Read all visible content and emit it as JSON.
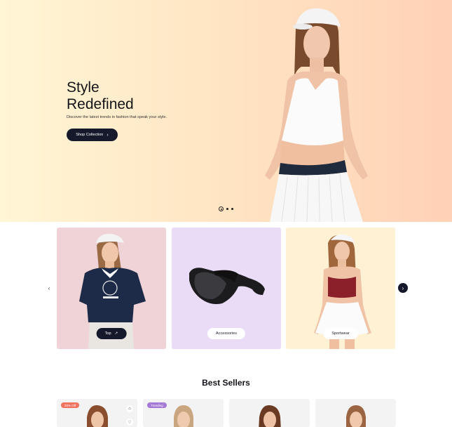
{
  "hero": {
    "title_line1": "Style",
    "title_line2": "Redefined",
    "subtitle": "Discover the latest trends in fashion that speak your style.",
    "cta_label": "Shop Collection",
    "slides_count": 3,
    "active_slide": 1
  },
  "categories": [
    {
      "label": "Top",
      "style": "dark"
    },
    {
      "label": "Accessories",
      "style": "light"
    },
    {
      "label": "Sportwear",
      "style": "light"
    }
  ],
  "best_sellers": {
    "title": "Best Sellers",
    "products": [
      {
        "badge": "20% Off",
        "badge_type": "sale"
      },
      {
        "badge": "Trending",
        "badge_type": "trend"
      },
      {
        "badge": ""
      },
      {
        "badge": ""
      }
    ]
  },
  "colors": {
    "dark": "#15192b",
    "sale_badge": "#f0735f",
    "trend_badge": "#a57ad6"
  }
}
